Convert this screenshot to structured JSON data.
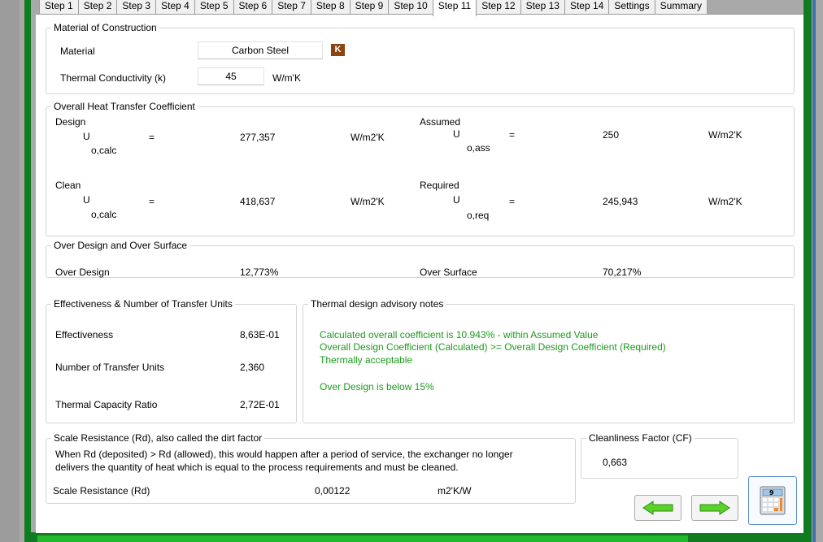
{
  "tabs": [
    "Step 1",
    "Step 2",
    "Step 3",
    "Step 4",
    "Step 5",
    "Step 6",
    "Step 7",
    "Step 8",
    "Step 9",
    "Step 10",
    "Step 11",
    "Step 12",
    "Step 13",
    "Step 14",
    "Settings",
    "Summary"
  ],
  "active_tab": "Step 11",
  "material_group": {
    "title": "Material of Construction",
    "material_label": "Material",
    "material_value": "Carbon Steel",
    "k_badge": "K",
    "conductivity_label": "Thermal Conductivity (k)",
    "conductivity_value": "45",
    "conductivity_unit": "W/m'K"
  },
  "u_group": {
    "title": "Overall Heat Transfer Coefficient",
    "design_label": "Design",
    "assumed_label": "Assumed",
    "clean_label": "Clean",
    "required_label": "Required",
    "u_symbol": "U",
    "eq": "=",
    "sub_calc": "o,calc",
    "sub_ass": "o,ass",
    "sub_req": "o,req",
    "design_value": "277,357",
    "assumed_value": "250",
    "clean_value": "418,637",
    "required_value": "245,943",
    "unit": "W/m2'K"
  },
  "over_group": {
    "title": "Over Design and Over Surface",
    "over_design_label": "Over Design",
    "over_design_value": "12,773%",
    "over_surface_label": "Over Surface",
    "over_surface_value": "70,217%"
  },
  "ntu_group": {
    "title": "Effectiveness & Number of Transfer Units",
    "effectiveness_label": "Effectiveness",
    "effectiveness_value": "8,63E-01",
    "ntu_label": "Number of Transfer Units",
    "ntu_value": "2,360",
    "capacity_label": "Thermal Capacity Ratio",
    "capacity_value": "2,72E-01"
  },
  "notes_group": {
    "title": "Thermal design advisory notes",
    "line1": "Calculated overall coefficient is 10.943% - within Assumed Value",
    "line2": "Overall Design Coefficient (Calculated) >= Overall Design Coefficient (Required)",
    "line3": "Thermally acceptable",
    "line4": "Over Design is below 15%"
  },
  "scale_group": {
    "title": "Scale Resistance (Rd), also called the dirt factor",
    "desc1": "When Rd (deposited) > Rd (allowed), this would happen after a period of service, the exchanger no longer",
    "desc2": "delivers the quantity of heat which is equal to the process requirements and must be cleaned.",
    "rd_label": "Scale Resistance (Rd)",
    "rd_value": "0,00122",
    "rd_unit": "m2'K/W"
  },
  "cleanliness_group": {
    "title": "Cleanliness Factor (CF)",
    "value": "0,663"
  },
  "buttons": {
    "back_icon": "left-arrow-icon",
    "next_icon": "right-arrow-icon",
    "calc_icon": "calculator-icon"
  },
  "progress": 0.85,
  "colors": {
    "frame_green": "#0f7d1f",
    "note_green": "#1b9b1b",
    "progress_green": "#23b82c",
    "k_badge": "#8b4513"
  }
}
